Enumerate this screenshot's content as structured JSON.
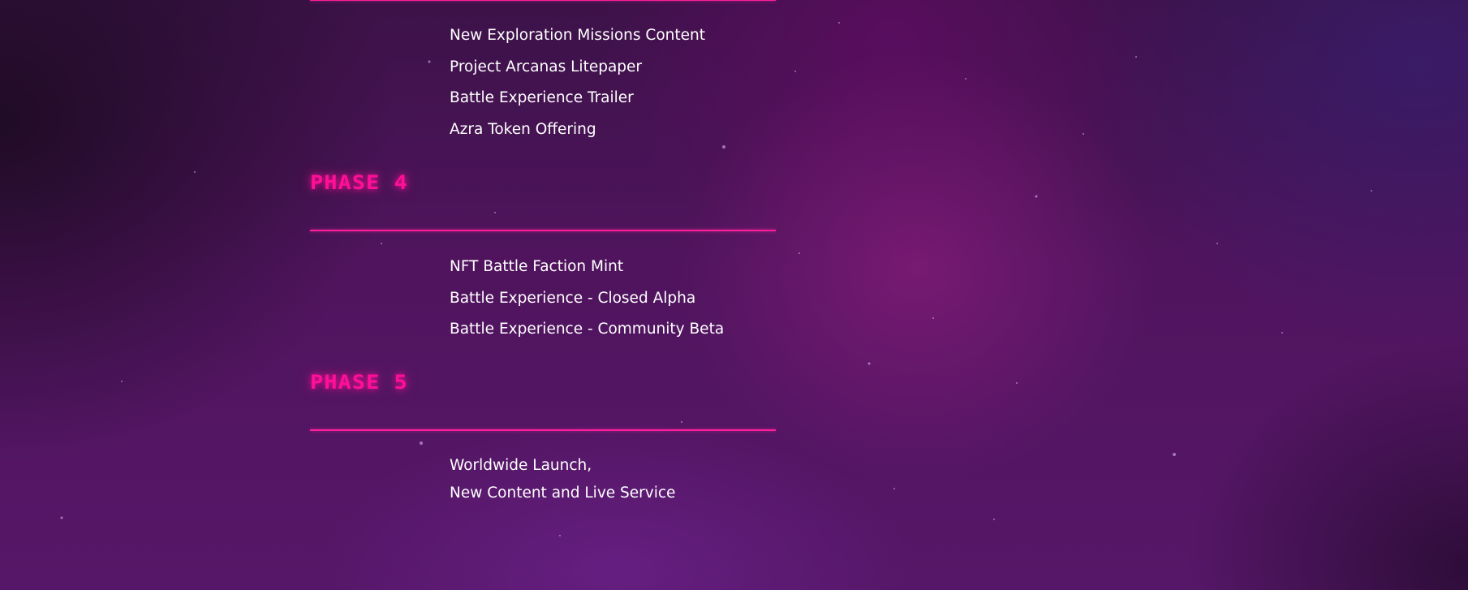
{
  "roadmap": {
    "phase3_items": [
      "New Exploration Missions Content",
      "Project Arcanas Litepaper",
      "Battle Experience Trailer",
      "Azra Token Offering"
    ],
    "phase4": {
      "title": "PHASE 4",
      "items": [
        "NFT Battle Faction Mint",
        "Battle Experience - Closed Alpha",
        "Battle Experience - Community Beta"
      ]
    },
    "phase5": {
      "title": "PHASE 5",
      "items": [
        "Worldwide Launch,",
        "New Content and Live Service"
      ]
    }
  },
  "colors": {
    "accent": "#ff0f98",
    "rule": "#ff1f9a",
    "text": "#ffffff",
    "background": "#50145e"
  }
}
